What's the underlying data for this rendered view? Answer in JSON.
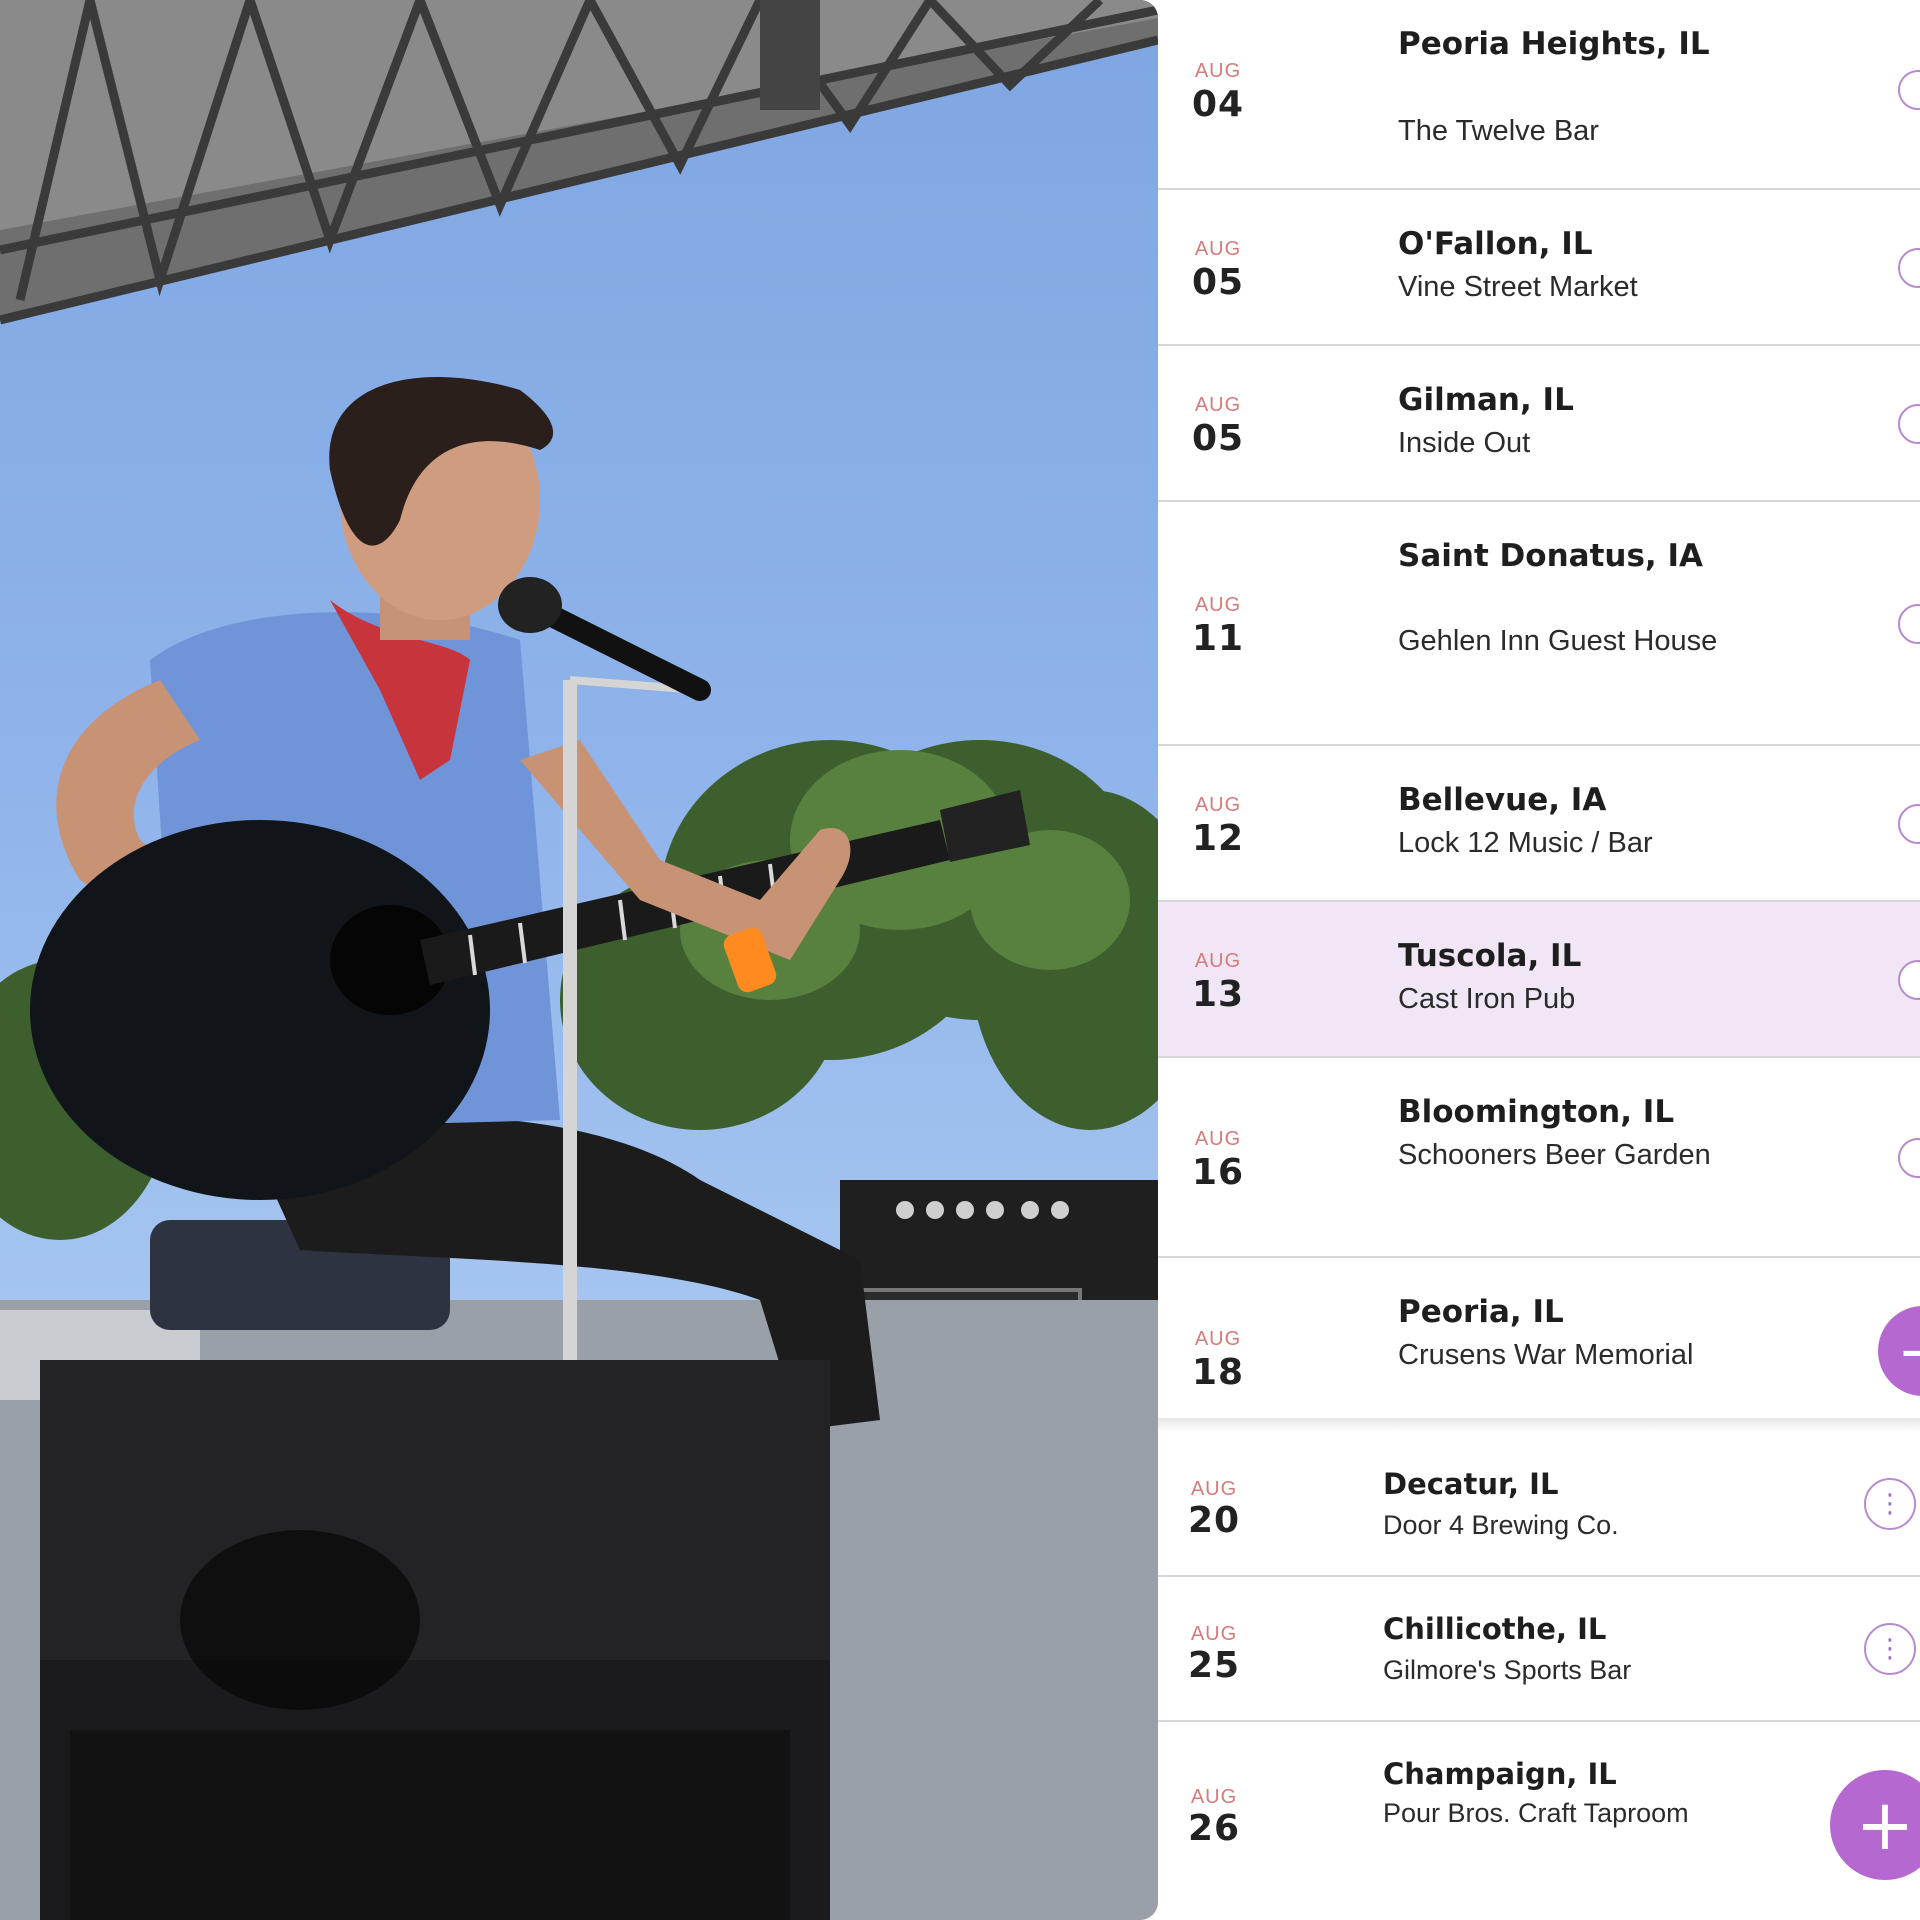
{
  "colors": {
    "accent": "#b568cf",
    "month": "#d67a7a",
    "highlight_row": "#f1e6f6"
  },
  "photo": {
    "description_icon": "performer-photo"
  },
  "events": [
    {
      "month": "AUG",
      "day": "04",
      "city": "Peoria Heights, IL",
      "venue": "The Twelve Bar"
    },
    {
      "month": "AUG",
      "day": "05",
      "city": "O'Fallon, IL",
      "venue": "Vine Street Market"
    },
    {
      "month": "AUG",
      "day": "05",
      "city": "Gilman, IL",
      "venue": "Inside Out"
    },
    {
      "month": "AUG",
      "day": "11",
      "city": "Saint Donatus, IA",
      "venue": "Gehlen Inn Guest House"
    },
    {
      "month": "AUG",
      "day": "12",
      "city": "Bellevue, IA",
      "venue": "Lock 12 Music / Bar"
    },
    {
      "month": "AUG",
      "day": "13",
      "city": "Tuscola, IL",
      "venue": "Cast Iron Pub"
    },
    {
      "month": "AUG",
      "day": "16",
      "city": "Bloomington, IL",
      "venue": "Schooners Beer Garden"
    },
    {
      "month": "AUG",
      "day": "18",
      "city": "Peoria, IL",
      "venue": "Crusens War Memorial"
    },
    {
      "month": "AUG",
      "day": "20",
      "city": "Decatur, IL",
      "venue": "Door 4 Brewing Co."
    },
    {
      "month": "AUG",
      "day": "25",
      "city": "Chillicothe, IL",
      "venue": "Gilmore's Sports Bar"
    },
    {
      "month": "AUG",
      "day": "26",
      "city": "Champaign, IL",
      "venue": "Pour Bros. Craft Taproom"
    }
  ],
  "actions": {
    "more_glyph": "⋮",
    "add_glyph": "+"
  }
}
